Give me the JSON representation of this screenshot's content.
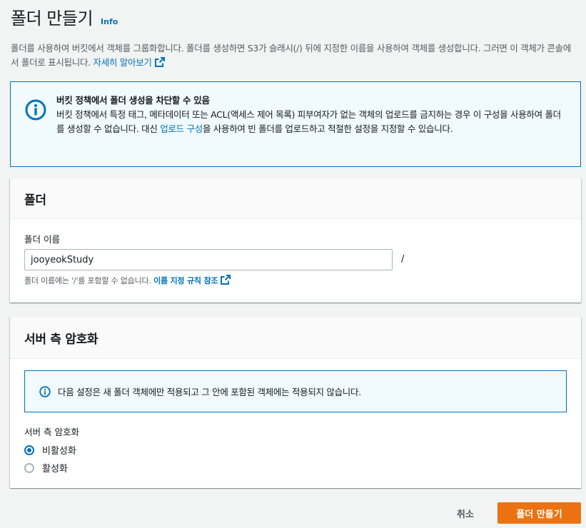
{
  "header": {
    "title": "폴더 만들기",
    "info_label": "Info"
  },
  "description": {
    "text": "폴더를 사용하여 버킷에서 객체를 그룹화합니다. 폴더를 생성하면 S3가 슬래시(/) 뒤에 지정한 이름을 사용하여 객체를 생성합니다. 그러면 이 객체가 콘솔에서 폴더로 표시됩니다.",
    "link_text": "자세히 알아보기"
  },
  "alert": {
    "title": "버킷 정책에서 폴더 생성을 차단할 수 있음",
    "body_before": "버킷 정책에서 특정 태그, 메타데이터 또는 ACL(액세스 제어 목록) 피부여자가 없는 객체의 업로드를 금지하는 경우 이 구성을 사용하여 폴더를 생성할 수 없습니다. 대신 ",
    "body_link": "업로드 구성",
    "body_after": "을 사용하여 빈 폴더를 업로드하고 적절한 설정을 지정할 수 있습니다."
  },
  "folder_panel": {
    "title": "폴더",
    "name_label": "폴더 이름",
    "name_value": "jooyeokStudy",
    "slash": "/",
    "constraint_text": "폴더 이름에는 '/'를 포함할 수 없습니다.",
    "constraint_link": "이름 지정 규칙 참조"
  },
  "encryption_panel": {
    "title": "서버 측 암호화",
    "info_text": "다음 설정은 새 폴더 객체에만 적용되고 그 안에 포함된 객체에는 적용되지 않습니다.",
    "group_label": "서버 측 암호화",
    "options": [
      {
        "label": "비활성화",
        "selected": true
      },
      {
        "label": "활성화",
        "selected": false
      }
    ]
  },
  "footer": {
    "cancel_label": "취소",
    "submit_label": "폴더 만들기"
  },
  "colors": {
    "accent": "#0073bb",
    "primary_button": "#ec7211",
    "info_background": "#f1faff"
  }
}
